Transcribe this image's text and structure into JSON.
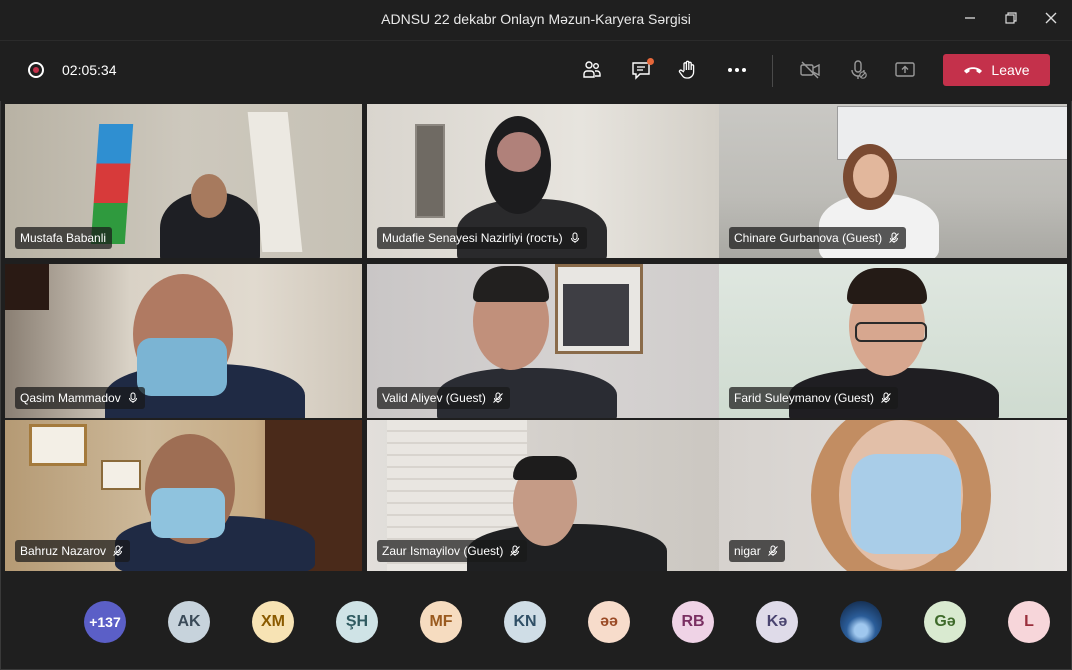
{
  "window": {
    "title": "ADNSU 22 dekabr Onlayn Məzun-Karyera Sərgisi"
  },
  "controls": {
    "recording_time": "02:05:34",
    "leave_label": "Leave",
    "icons": [
      "people-icon",
      "chat-icon",
      "raise-hand-icon",
      "more-icon",
      "camera-off-icon",
      "mic-off-icon",
      "share-tray-icon",
      "phone-hangup-icon"
    ]
  },
  "participants_video": [
    {
      "name": "Mustafa Babanli",
      "muted": false
    },
    {
      "name": "Mudafie Senayesi Nazirliyi (гость)",
      "muted": true
    },
    {
      "name": "Chinare Gurbanova (Guest)",
      "muted": true
    },
    {
      "name": "Qasim Mammadov",
      "muted": true
    },
    {
      "name": "Valid Aliyev (Guest)",
      "muted": true
    },
    {
      "name": "Farid Suleymanov (Guest)",
      "muted": true
    },
    {
      "name": "Bahruz Nazarov",
      "muted": true
    },
    {
      "name": "Zaur Ismayilov (Guest)",
      "muted": true
    },
    {
      "name": "nigar",
      "muted": true
    }
  ],
  "participants_bar": [
    {
      "initials": "+137",
      "bg": "#5b5fc7",
      "fg": "#ffffff"
    },
    {
      "initials": "AK",
      "bg": "#c7d3dc",
      "fg": "#3a4a58"
    },
    {
      "initials": "XM",
      "bg": "#f7e3b4",
      "fg": "#8a5a00"
    },
    {
      "initials": "ŞH",
      "bg": "#cfe3e6",
      "fg": "#2f5a60"
    },
    {
      "initials": "MF",
      "bg": "#f6dcc0",
      "fg": "#9a5a1e"
    },
    {
      "initials": "KN",
      "bg": "#cfdde6",
      "fg": "#2f4f66"
    },
    {
      "initials": "əə",
      "bg": "#f7dccb",
      "fg": "#9a4a25"
    },
    {
      "initials": "RB",
      "bg": "#efd3e6",
      "fg": "#7a2f62"
    },
    {
      "initials": "Kə",
      "bg": "#dfdbe9",
      "fg": "#4a4470"
    },
    {
      "initials": "",
      "bg": "#1d3f6d",
      "fg": "#ffffff"
    },
    {
      "initials": "Gə",
      "bg": "#d9ead0",
      "fg": "#3e6a2a"
    },
    {
      "initials": "L",
      "bg": "#f7d6da",
      "fg": "#9a2f3c"
    }
  ],
  "colors": {
    "leave": "#c4314b",
    "background": "#1f1f1f"
  }
}
